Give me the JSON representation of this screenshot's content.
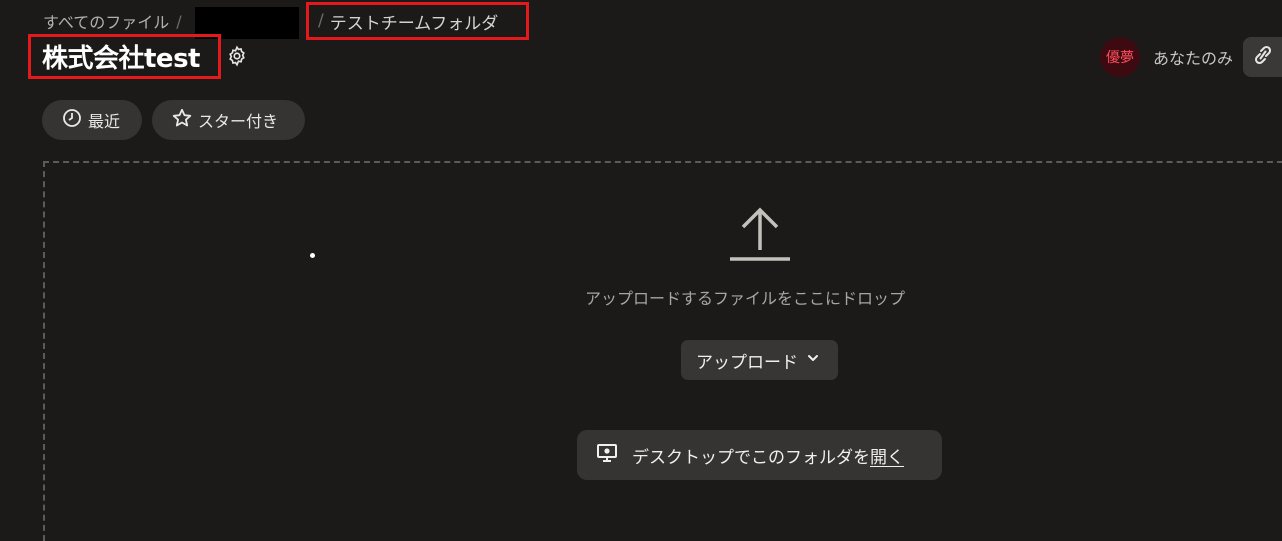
{
  "breadcrumb": {
    "root_label": "すべてのファイル",
    "separator": "/",
    "current_label": "テストチームフォルダ"
  },
  "page": {
    "title": "株式会社test"
  },
  "user": {
    "avatar_text": "優夢",
    "avatar_color": "#3d0a12",
    "access_label": "あなたのみ"
  },
  "filters": {
    "recent_label": "最近",
    "starred_label": "スター付き"
  },
  "dropzone": {
    "drop_text": "アップロードするファイルをここにドロップ",
    "upload_button_label": "アップロード",
    "desktop_button_label_prefix": "デスクトップでこのフォルダを",
    "desktop_button_label_link": "開く"
  },
  "icons": {
    "settings": "gear-icon",
    "link": "link-icon",
    "recent": "clock-icon",
    "starred": "star-icon",
    "upload": "upload-arrow-icon",
    "chevron": "chevron-down-icon",
    "desktop": "monitor-icon"
  },
  "colors": {
    "background": "#1b1a19",
    "highlight_border": "#e3191b",
    "button_bg": "#353432"
  }
}
